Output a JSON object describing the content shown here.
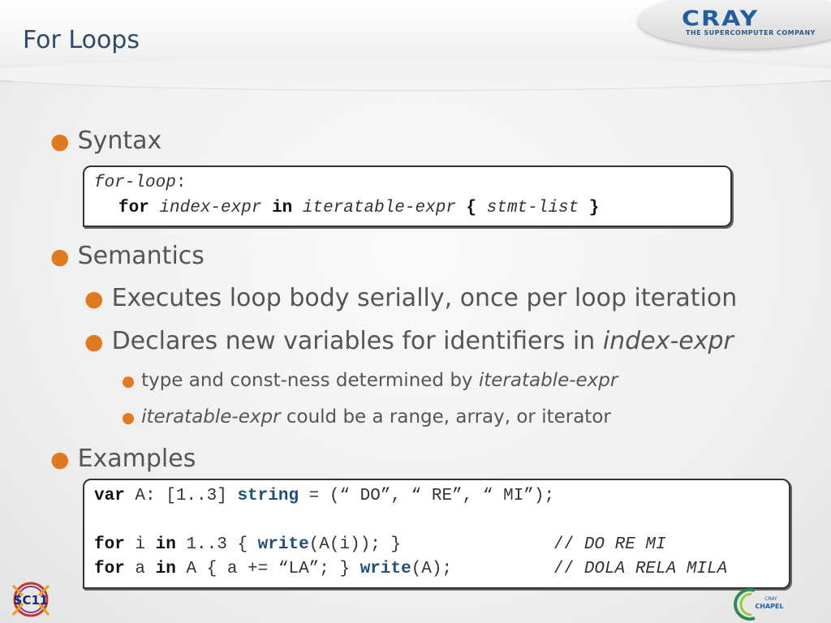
{
  "slide": {
    "title": "For Loops"
  },
  "logo": {
    "company_name": "CRAY",
    "tagline": "THE SUPERCOMPUTER COMPANY",
    "sc_logo_text": "SC11",
    "chapel_logo_text": "CHAPEL",
    "chapel_logo_small": "CRAY"
  },
  "bullets": {
    "syntax": "Syntax",
    "semantics": "Semantics",
    "sem_1": "Executes loop body serially, once per loop iteration",
    "sem_2_pre": "Declares new variables for identifiers in ",
    "sem_2_em": "index-expr",
    "sem_2a_pre": "type and const-ness determined by ",
    "sem_2a_em": "iteratable-expr",
    "sem_2b_em": "iteratable-expr",
    "sem_2b_post": " could be a range, array, or iterator",
    "examples": "Examples"
  },
  "syntax_box": {
    "line1_em": "for-loop",
    "line1_colon": ":",
    "for_kw": "for",
    "index_expr": "index-expr",
    "in_kw": "in",
    "iter_expr": "iteratable-expr",
    "open_brace": "{",
    "stmt_list": "stmt-list",
    "close_brace": "}"
  },
  "example_box": {
    "l1_var": "var",
    "l1_a": " A: [1..3] ",
    "l1_string": "string",
    "l1_rest": " = (“ DO”, “ RE”, “ MI”);",
    "l2_for": "for",
    "l2_i": " i ",
    "l2_in": "in",
    "l2_mid": " 1..3 { ",
    "l2_write": "write",
    "l2_rest": "(A(i)); }",
    "l2_comment_slash": "// ",
    "l2_comment": "DO RE MI",
    "l3_for": "for",
    "l3_a": " a ",
    "l3_in": "in",
    "l3_mid": " A { a += “LA”; } ",
    "l3_write": "write",
    "l3_rest": "(A);",
    "l3_comment_slash": "// ",
    "l3_comment": "DOLA RELA MILA"
  },
  "colors": {
    "title": "#2d4a6e",
    "bullet": "#e07a1e",
    "text": "#555555",
    "keyword_blue": "#1f4f7a",
    "cray_blue": "#1f5fa0"
  }
}
